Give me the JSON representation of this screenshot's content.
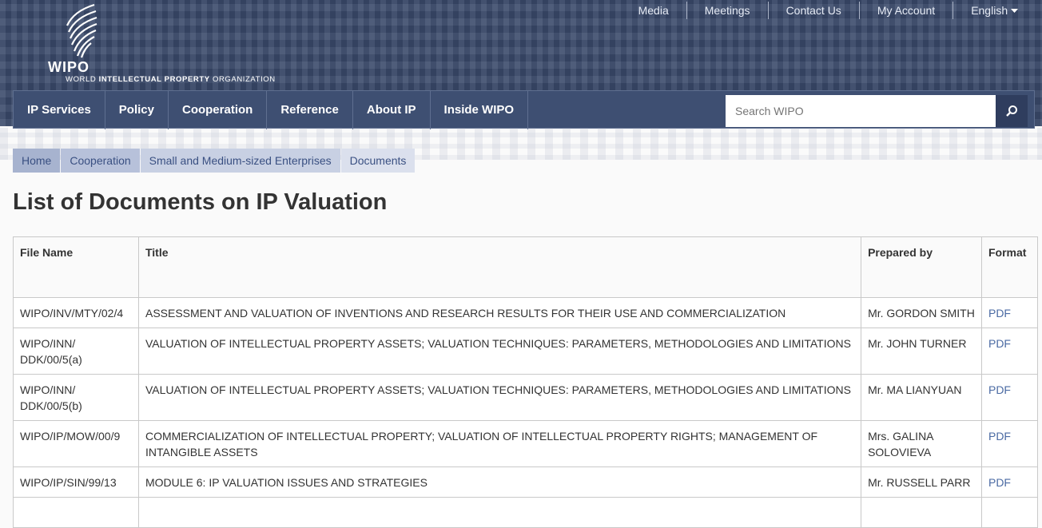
{
  "header": {
    "logo_text": "WIPO",
    "org_part1": "WORLD ",
    "org_part2": "INTELLECTUAL PROPERTY",
    "org_part3": " ORGANIZATION",
    "top_links": [
      "Media",
      "Meetings",
      "Contact Us",
      "My Account"
    ],
    "language": "English",
    "nav": [
      "IP Services",
      "Policy",
      "Cooperation",
      "Reference",
      "About IP",
      "Inside WIPO"
    ],
    "search_placeholder": "Search WIPO"
  },
  "breadcrumb": [
    "Home",
    "Cooperation",
    "Small and Medium-sized Enterprises",
    "Documents"
  ],
  "page_title": "List of Documents on IP Valuation",
  "table": {
    "headers": [
      "File Name",
      "Title",
      "Prepared by",
      "Format"
    ],
    "rows": [
      [
        "WIPO/INV/MTY/02/4",
        "ASSESSMENT AND VALUATION OF INVENTIONS AND RESEARCH RESULTS FOR THEIR USE AND COMMERCIALIZATION",
        "Mr. GORDON SMITH",
        "PDF"
      ],
      [
        "WIPO/INN/ DDK/00/5(a)",
        "VALUATION OF INTELLECTUAL PROPERTY ASSETS; VALUATION TECHNIQUES: PARAMETERS, METHODOLOGIES AND LIMITATIONS",
        "Mr. JOHN TURNER",
        "PDF"
      ],
      [
        "WIPO/INN/ DDK/00/5(b)",
        "VALUATION OF INTELLECTUAL PROPERTY ASSETS; VALUATION TECHNIQUES: PARAMETERS, METHODOLOGIES AND LIMITATIONS",
        "Mr. MA LIANYUAN",
        "PDF"
      ],
      [
        "WIPO/IP/MOW/00/9",
        "COMMERCIALIZATION OF INTELLECTUAL PROPERTY; VALUATION OF INTELLECTUAL PROPERTY RIGHTS; MANAGEMENT OF INTANGIBLE ASSETS",
        "Mrs. GALINA SOLOVIEVA",
        "PDF"
      ],
      [
        "WIPO/IP/SIN/99/13",
        "MODULE 6: IP VALUATION ISSUES AND STRATEGIES",
        "Mr. RUSSELL PARR",
        "PDF"
      ]
    ]
  },
  "colors": {
    "header_bg": "#3a4a6b",
    "nav_bg": "#3e4f72",
    "link": "#4a6aa3"
  },
  "icons": {
    "search": "search-icon",
    "language": "chevron-down-icon",
    "logo": "wipo-globe-icon"
  }
}
